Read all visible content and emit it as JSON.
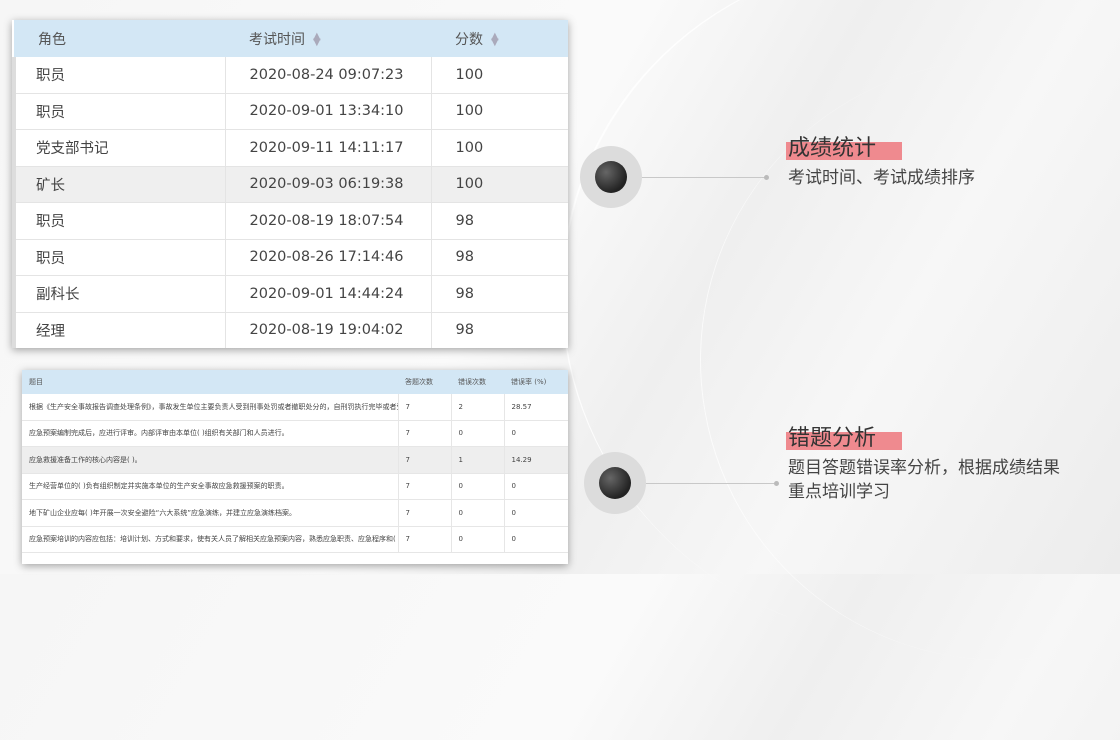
{
  "scores_table": {
    "headers": [
      "角色",
      "考试时间",
      "分数"
    ],
    "rows": [
      [
        "职员",
        "2020-08-24 09:07:23",
        "100"
      ],
      [
        "职员",
        "2020-09-01 13:34:10",
        "100"
      ],
      [
        "党支部书记",
        "2020-09-11 14:11:17",
        "100"
      ],
      [
        "矿长",
        "2020-09-03 06:19:38",
        "100"
      ],
      [
        "职员",
        "2020-08-19 18:07:54",
        "98"
      ],
      [
        "职员",
        "2020-08-26 17:14:46",
        "98"
      ],
      [
        "副科长",
        "2020-09-01 14:44:24",
        "98"
      ],
      [
        "经理",
        "2020-08-19 19:04:02",
        "98"
      ]
    ],
    "highlighted_row": 3
  },
  "errors_table": {
    "headers": [
      "题目",
      "答题次数",
      "错误次数",
      "错误率 (%)"
    ],
    "rows": [
      [
        "根据《生产安全事故报告调查处理条例》，事故发生单位主要负责人受到刑事处罚或者撤职处分的，自刑罚执行完毕或者受...",
        "7",
        "2",
        "28.57"
      ],
      [
        "应急预案编制完成后，应进行评审。内部评审由本单位(  )组织有关部门和人员进行。",
        "7",
        "0",
        "0"
      ],
      [
        "应急救援准备工作的核心内容是(  )。",
        "7",
        "1",
        "14.29"
      ],
      [
        "生产经营单位的(  )负有组织制定并实施本单位的生产安全事故应急救援预案的职责。",
        "7",
        "0",
        "0"
      ],
      [
        "地下矿山企业应每(  )年开展一次安全避险“六大系统”应急演练，并建立应急演练档案。",
        "7",
        "0",
        "0"
      ],
      [
        "应急预案培训的内容应包括：培训计划、方式和要求，使有关人员了解相关应急预案内容，熟悉应急职责、应急程序和(  )。",
        "7",
        "0",
        "0"
      ]
    ],
    "highlighted_row": 2
  },
  "features": [
    {
      "title": "成绩统计",
      "desc": "考试时间、考试成绩排序"
    },
    {
      "title": "错题分析",
      "desc_line1": "题目答题错误率分析，根据成绩结果",
      "desc_line2": "重点培训学习"
    }
  ],
  "colors": {
    "header_bg": "#d3e7f5",
    "accent_bar": "#ef8a8f"
  }
}
